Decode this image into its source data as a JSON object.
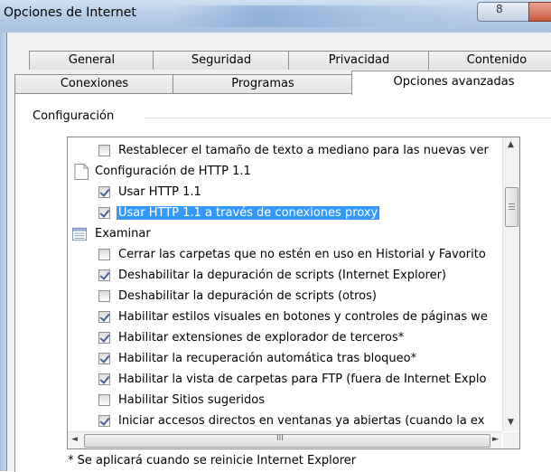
{
  "window": {
    "title": "Opciones de Internet",
    "minimize_glyph": "8"
  },
  "tabs_row1": [
    "General",
    "Seguridad",
    "Privacidad",
    "Contenido"
  ],
  "tabs_row2": [
    "Conexiones",
    "Programas",
    "Opciones avanzadas"
  ],
  "active_tab": "Opciones avanzadas",
  "group_label": "Configuración",
  "settings": [
    {
      "type": "checkbox",
      "label": "Restablecer el tamaño de texto a mediano para las nuevas ver",
      "checked": false
    },
    {
      "type": "category",
      "label": "Configuración de HTTP 1.1",
      "icon": "page-icon"
    },
    {
      "type": "checkbox",
      "label": "Usar HTTP 1.1",
      "checked": true
    },
    {
      "type": "checkbox",
      "label": "Usar HTTP 1.1 a través de conexiones proxy",
      "checked": true,
      "selected": true
    },
    {
      "type": "category",
      "label": "Examinar",
      "icon": "list-icon"
    },
    {
      "type": "checkbox",
      "label": "Cerrar las carpetas que no estén en uso en Historial y Favorito",
      "checked": false
    },
    {
      "type": "checkbox",
      "label": "Deshabilitar la depuración de scripts (Internet Explorer)",
      "checked": true
    },
    {
      "type": "checkbox",
      "label": "Deshabilitar la depuración de scripts (otros)",
      "checked": false
    },
    {
      "type": "checkbox",
      "label": "Habilitar estilos visuales en botones y controles de páginas we",
      "checked": true
    },
    {
      "type": "checkbox",
      "label": "Habilitar extensiones de explorador de terceros*",
      "checked": true
    },
    {
      "type": "checkbox",
      "label": "Habilitar la recuperación automática tras bloqueo*",
      "checked": true
    },
    {
      "type": "checkbox",
      "label": "Habilitar la vista de carpetas para FTP (fuera de Internet Explo",
      "checked": true
    },
    {
      "type": "checkbox",
      "label": "Habilitar Sitios sugeridos",
      "checked": false
    },
    {
      "type": "checkbox",
      "label": "Iniciar accesos directos en ventanas ya abiertas (cuando la ex",
      "checked": true
    }
  ],
  "scroll": {
    "up": "▲",
    "down": "▼",
    "left": "◄",
    "right": "►",
    "hgrip": "III"
  },
  "footnote": "* Se aplicará cuando se reinicie Internet Explorer"
}
